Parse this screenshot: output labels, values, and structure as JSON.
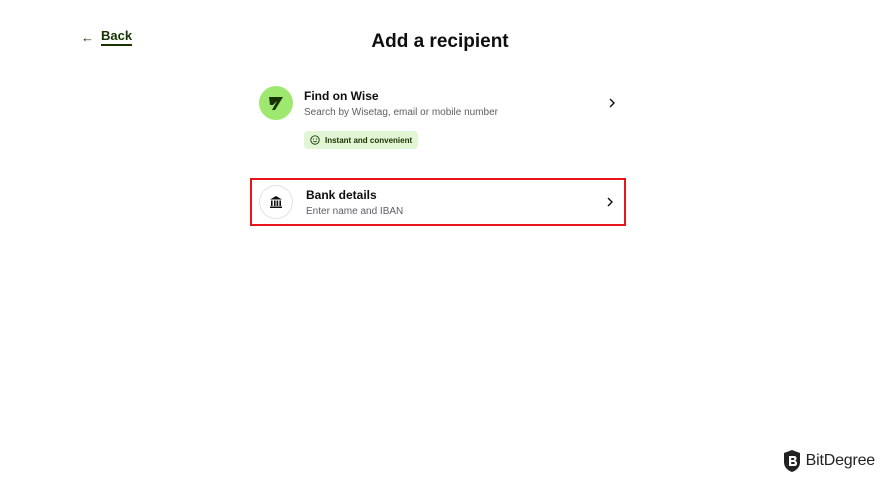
{
  "header": {
    "back_label": "Back",
    "title": "Add a recipient"
  },
  "options": [
    {
      "title": "Find on Wise",
      "subtitle": "Search by Wisetag, email or mobile number",
      "badge": "Instant and convenient",
      "icon": "wise-logo-icon"
    },
    {
      "title": "Bank details",
      "subtitle": "Enter name and IBAN",
      "icon": "bank-icon",
      "highlighted": true
    }
  ],
  "colors": {
    "accent_green": "#9fe870",
    "dark_green": "#163300",
    "badge_bg": "#e2f6d5",
    "highlight_red": "#e4151b"
  },
  "watermark": {
    "text": "BitDegree"
  }
}
